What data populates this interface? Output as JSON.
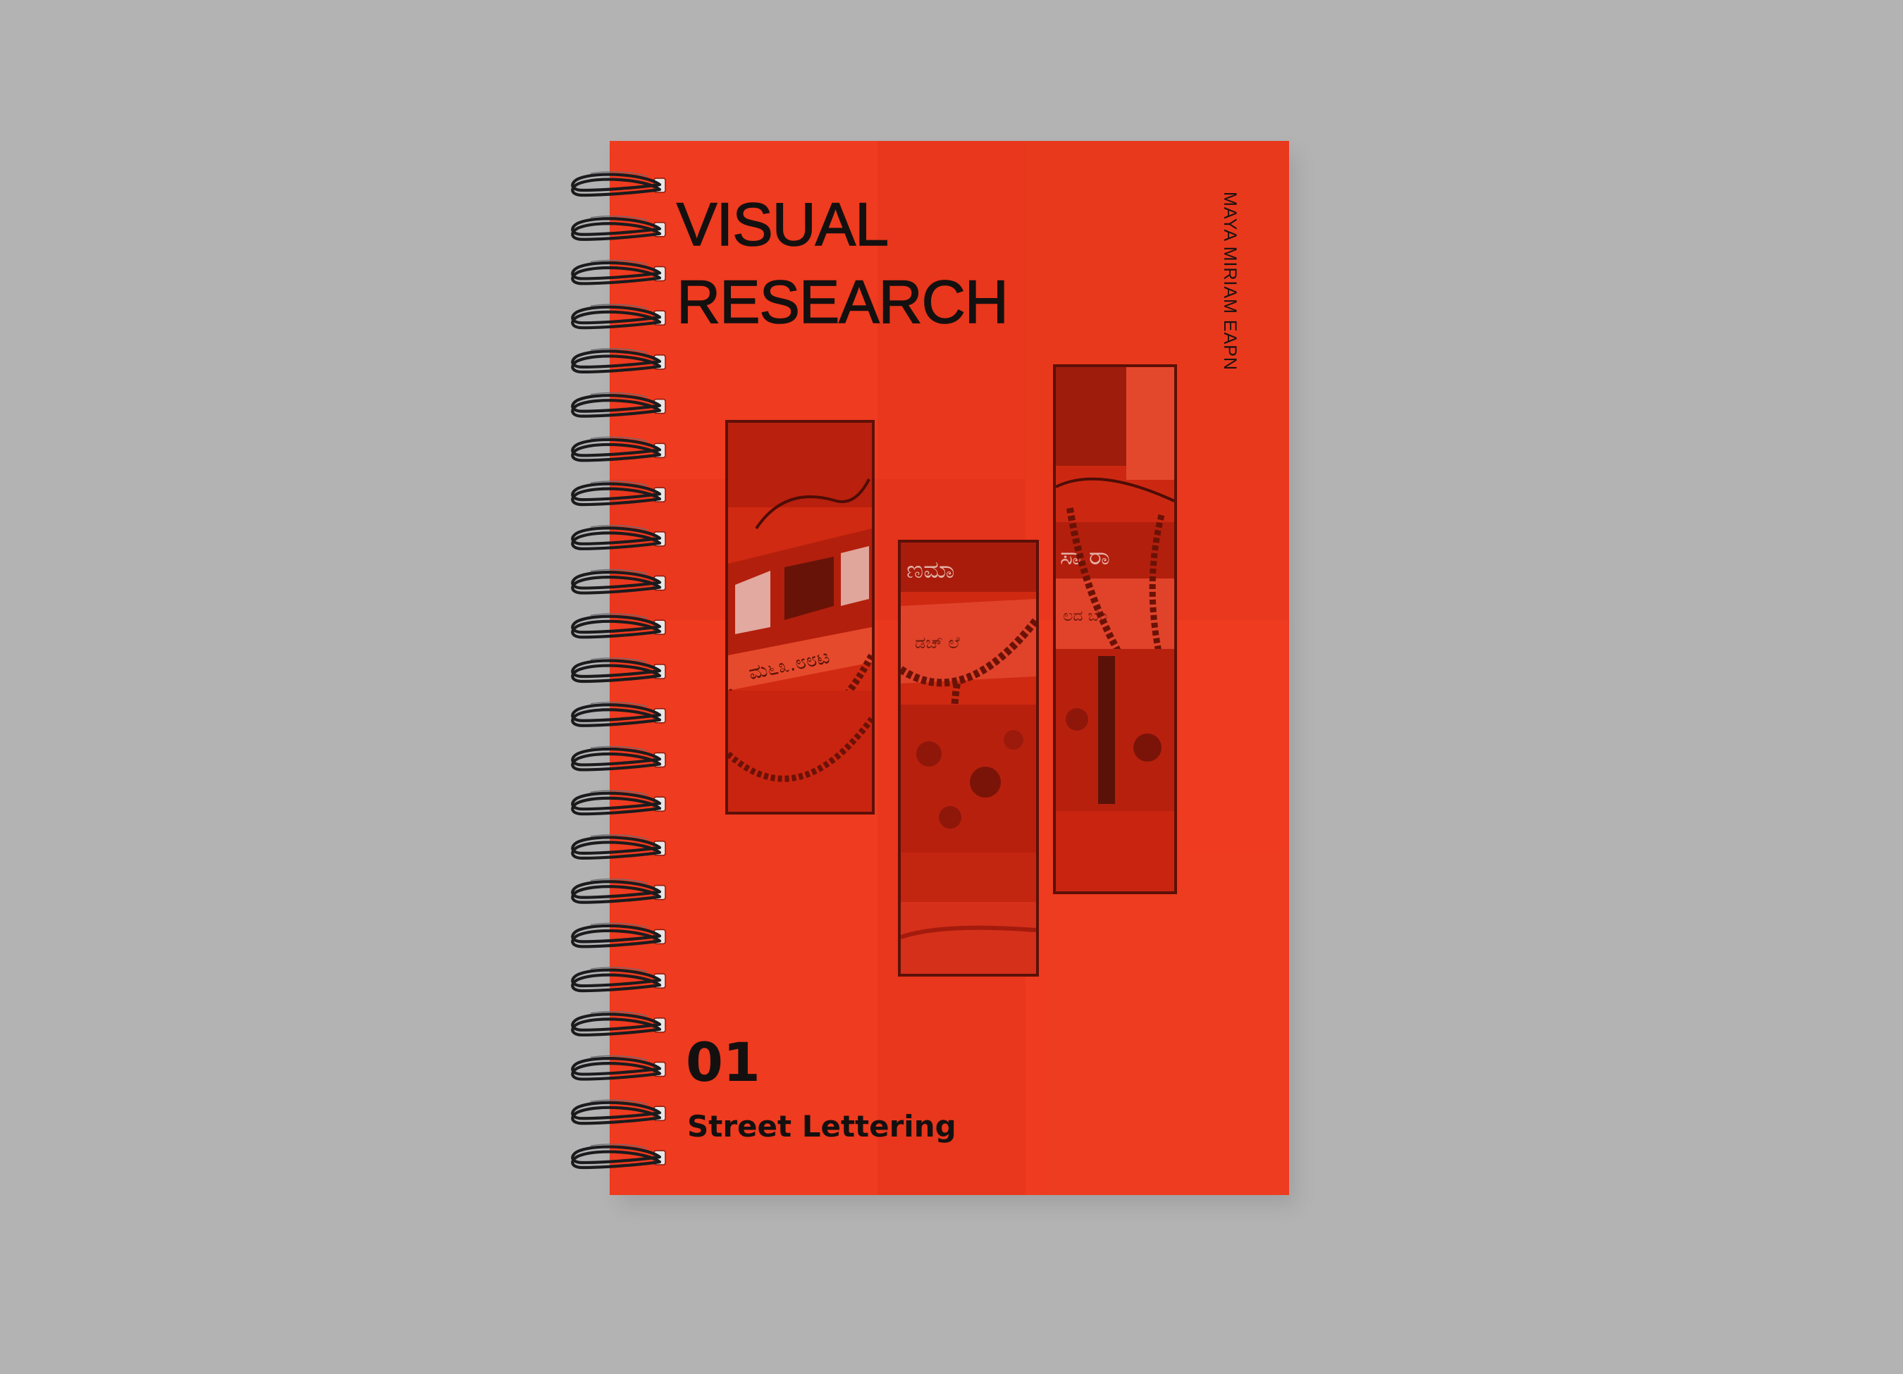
{
  "cover": {
    "title_line_1": "VISUAL",
    "title_line_2": "RESEARCH",
    "author": "MAYA MIRIAM EAPN",
    "issue_number": "01",
    "subtitle": "Street Lettering"
  },
  "colors": {
    "background": "#b3b3b3",
    "cover": "#ef3b1f",
    "text": "#141010",
    "photo_frame": "#5c1008"
  },
  "spiral_ring_count": 23
}
